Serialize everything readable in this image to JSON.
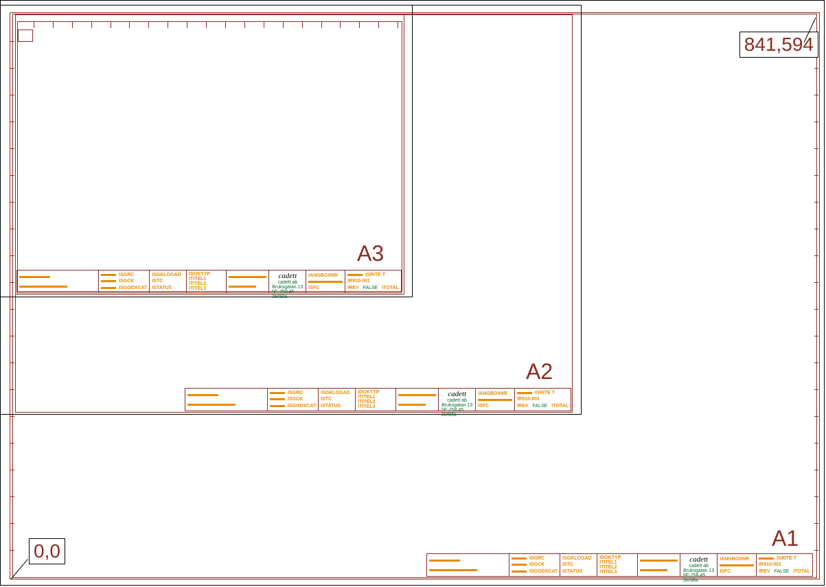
{
  "coords": {
    "origin": "0,0",
    "topright": "841,594"
  },
  "sheets": {
    "a1": "A1",
    "a2": "A2",
    "a3": "A3"
  },
  "titleblock": {
    "col1a": "ISGRC",
    "col1b": "ISGCK",
    "col1c": "ISGODXCAT",
    "col2a": "ISGKLOGAD",
    "col2b": "ISTC",
    "col2c": "ISTATUS",
    "col3a": "IDOKTYP",
    "col3b": "ITITEL1",
    "col3c": "ITITEL2",
    "col3d": "ITITEL3",
    "logo": "cadett",
    "addr1": "cadett ab",
    "addr2": "Bruksgatan 13",
    "addr3": "SE-758 45 Järfälla",
    "col5a": "IANGBOXNR",
    "col5b": "ISFC",
    "col6a": "IR910-001",
    "col6b": "ISRITE T",
    "col6c": "IREV",
    "col6d": "FALSE",
    "col6e": "ITOTAL"
  }
}
